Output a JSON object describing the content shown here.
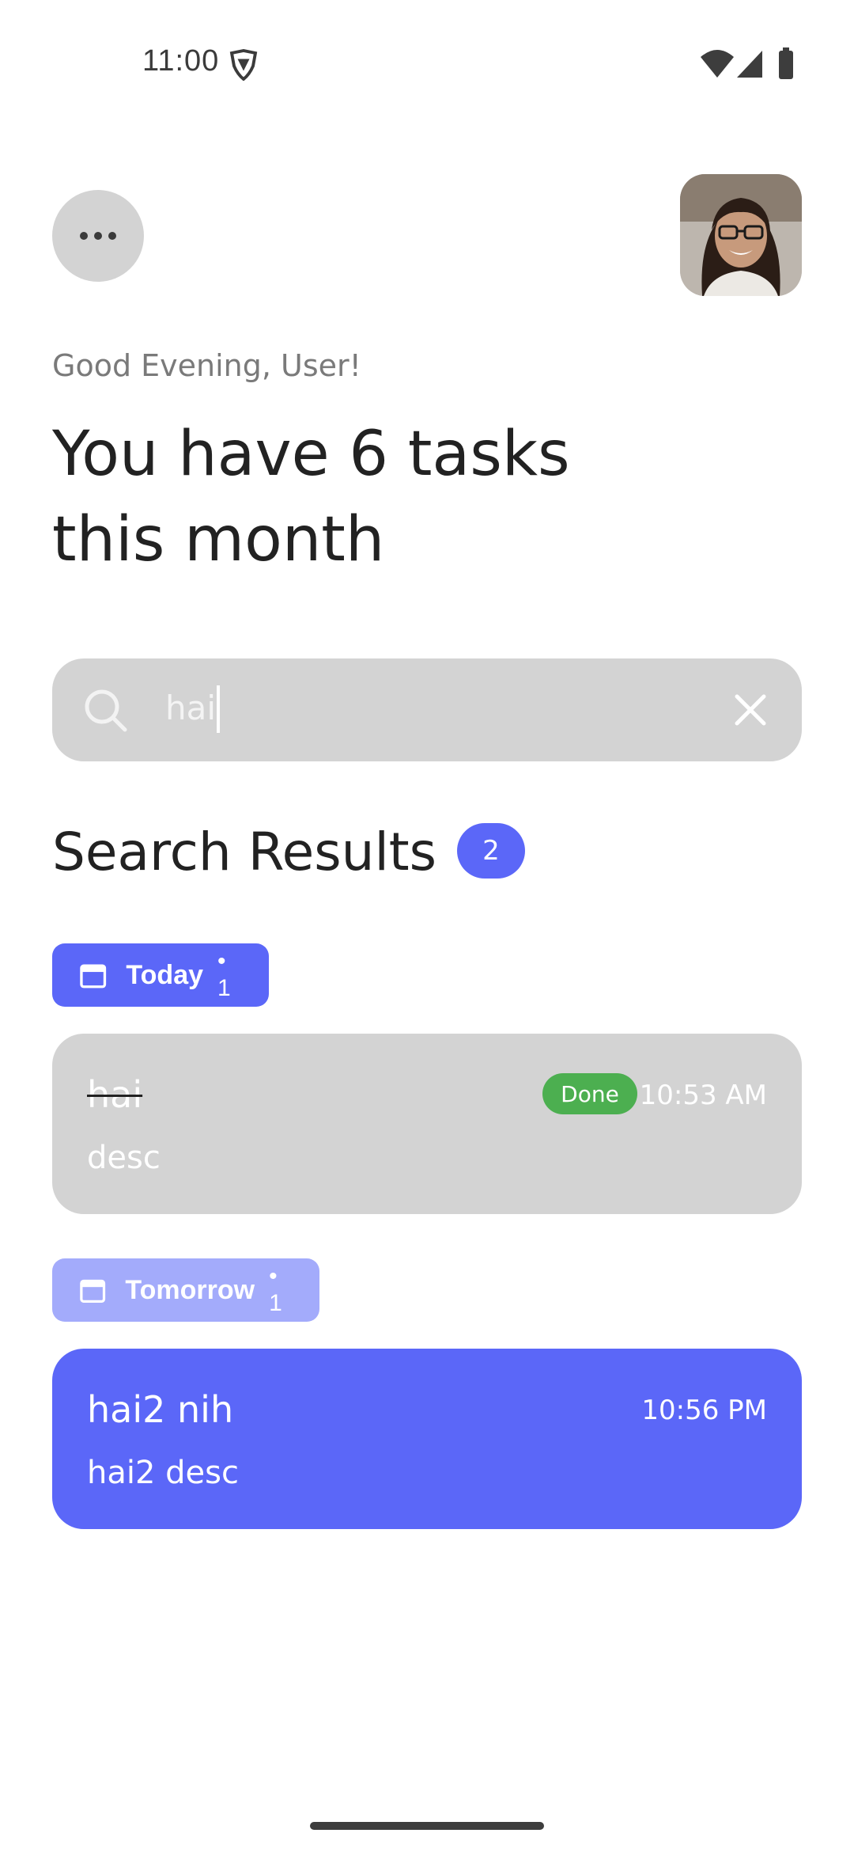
{
  "status_bar": {
    "time": "11:00",
    "icons": [
      "shield-icon",
      "wifi-icon",
      "cellular-icon",
      "battery-icon"
    ]
  },
  "header": {
    "menu_icon": "more-horizontal-icon",
    "avatar": "user-avatar-photo"
  },
  "greeting": "Good Evening, User!",
  "headline": "You have 6 tasks this month",
  "search": {
    "value": "hai",
    "icon": "search-icon",
    "clear_icon": "close-icon"
  },
  "results": {
    "title": "Search Results",
    "count": "2"
  },
  "groups": [
    {
      "label": "Today",
      "count": "• 1",
      "chip_color": "#5b67f8",
      "tasks": [
        {
          "title": "hai",
          "description": "desc",
          "status": "Done",
          "time": "10:53 AM",
          "card_color": "#d3d3d3",
          "completed": true
        }
      ]
    },
    {
      "label": "Tomorrow",
      "count": "• 1",
      "chip_color": "#a3abfb",
      "tasks": [
        {
          "title": "hai2 nih",
          "description": "hai2 desc",
          "time": "10:56 PM",
          "card_color": "#5b67f8",
          "completed": false
        }
      ]
    }
  ],
  "colors": {
    "accent": "#5b67f8",
    "accent_light": "#a3abfb",
    "done_green": "#4caf50",
    "card_grey": "#d3d3d3"
  }
}
